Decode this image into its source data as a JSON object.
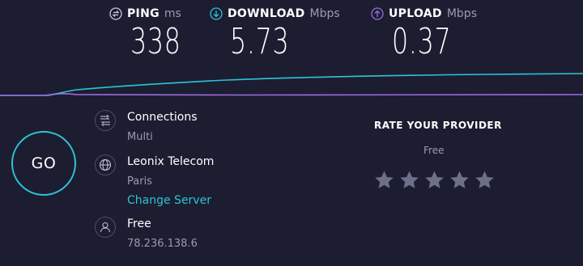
{
  "metrics": {
    "ping": {
      "name": "PING",
      "unit": "ms",
      "value": "338",
      "icon": "ping-icon",
      "color": "#ffffff"
    },
    "download": {
      "name": "DOWNLOAD",
      "unit": "Mbps",
      "value": "5.73",
      "icon": "download-icon",
      "color": "#2ec4d6"
    },
    "upload": {
      "name": "UPLOAD",
      "unit": "Mbps",
      "value": "0.37",
      "icon": "upload-icon",
      "color": "#9b6bdf"
    }
  },
  "go_label": "GO",
  "connections": {
    "title": "Connections",
    "value": "Multi",
    "icon": "connections-icon"
  },
  "server": {
    "provider": "Leonix Telecom",
    "city": "Paris",
    "change_label": "Change Server",
    "icon": "globe-icon"
  },
  "user": {
    "provider": "Free",
    "ip": "78.236.138.6",
    "icon": "user-icon"
  },
  "rating": {
    "title": "RATE YOUR PROVIDER",
    "provider": "Free",
    "stars": 5,
    "star_color": "#6e7089"
  },
  "colors": {
    "background": "#1c1d31",
    "accent": "#2ec4d6",
    "upload": "#9b6bdf",
    "muted": "#9a9bb4"
  }
}
